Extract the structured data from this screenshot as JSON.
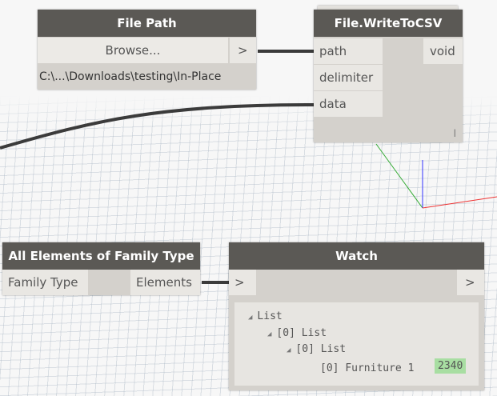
{
  "file_path_node": {
    "title": "File Path",
    "browse_label": "Browse...",
    "output_port": ">",
    "path_value": "C:\\...\\Downloads\\testing\\In-Place"
  },
  "write_csv_node": {
    "title": "File.WriteToCSV",
    "inputs": [
      "path",
      "delimiter",
      "data"
    ],
    "output": "void",
    "lacing": "l"
  },
  "family_type_node": {
    "title": "All Elements of Family Type",
    "input": "Family Type",
    "output": "Elements"
  },
  "watch_node": {
    "title": "Watch",
    "input_port": ">",
    "output_port": ">",
    "tree": {
      "root": "List",
      "level1": "[0] List",
      "level2": "[0] List",
      "item_index": "[0]",
      "item_label": "Furniture 1",
      "item_value": "2340"
    }
  }
}
